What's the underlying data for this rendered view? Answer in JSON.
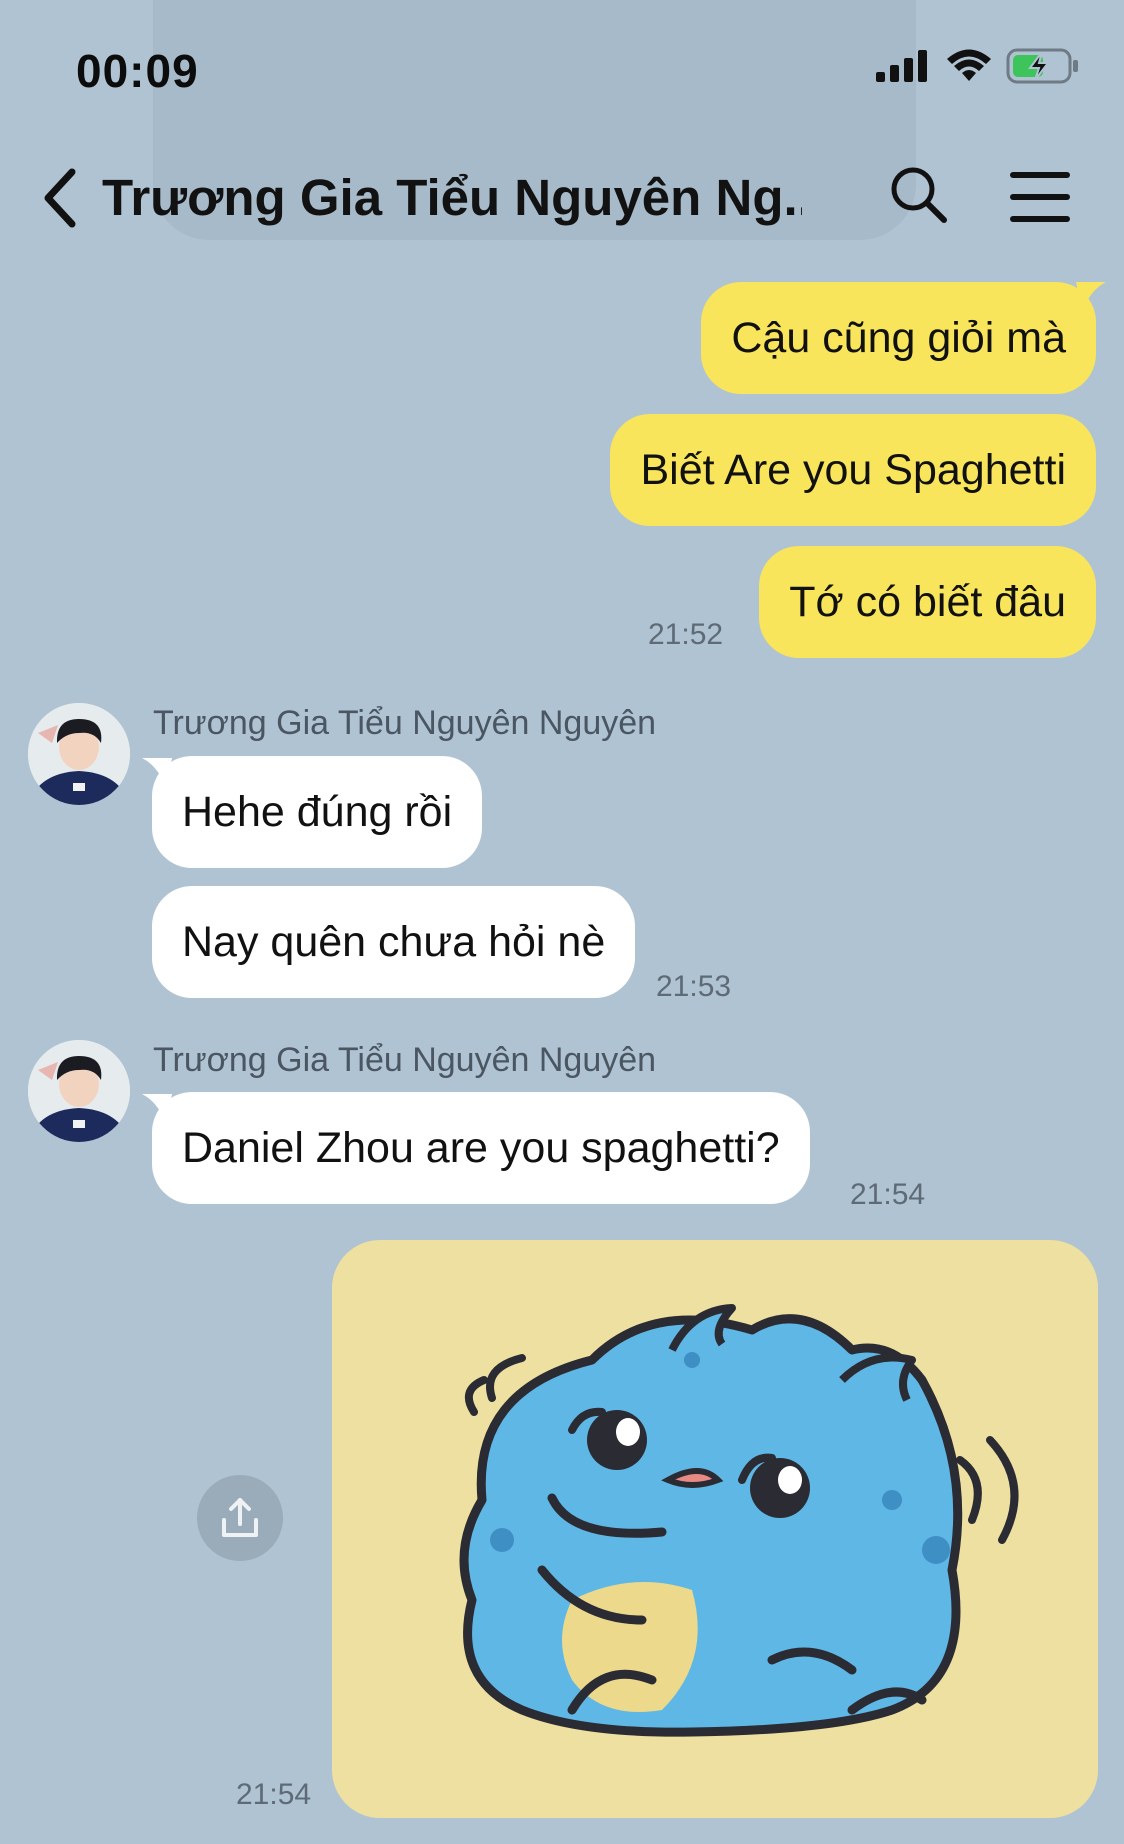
{
  "status_bar": {
    "time": "00:09",
    "battery": "charging"
  },
  "header": {
    "title": "Trương Gia Tiểu Nguyên Ng..."
  },
  "messages": {
    "out1": "Cậu cũng giỏi mà",
    "out2": "Biết Are you Spaghetti",
    "out3": "Tớ có biết đâu",
    "time1": "21:52",
    "sender1": "Trương Gia Tiểu Nguyên Nguyên",
    "in1": "Hehe đúng rồi",
    "in2": "Nay quên chưa hỏi nè",
    "time2": "21:53",
    "sender2": "Trương Gia Tiểu Nguyên Nguyên",
    "in3": "Daniel Zhou are you spaghetti?",
    "time3": "21:54",
    "time4": "21:54"
  },
  "icons": [
    "back-chevron-icon",
    "search-icon",
    "menu-icon",
    "share-icon",
    "signal-icon",
    "wifi-icon",
    "battery-icon"
  ],
  "colors": {
    "background": "#b0c3d3",
    "outgoing_bubble": "#f8e55b",
    "incoming_bubble": "#ffffff",
    "sticker_bg": "#ede0a0",
    "sticker_body": "#5fb7e6"
  }
}
